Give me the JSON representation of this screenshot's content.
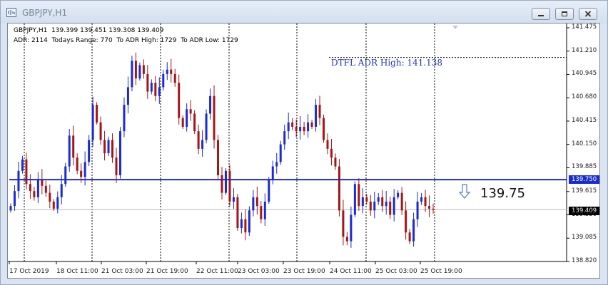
{
  "window": {
    "title": "GBPJPY,H1"
  },
  "chart": {
    "info_line1": "GBPJPY,H1  139.399 139.451 139.308 139.409",
    "info_line2": "ADR: 2114  Todays Range: 770  To ADR High: 1729  To ADR Low: 1729",
    "adr_label": "DTFL ADR High: 141.138",
    "big_price": "139.75",
    "level_tag": "139.750",
    "current_tag": "139.409",
    "colors": {
      "bull": "#1a2ccf",
      "bear": "#a31616",
      "level": "#1a2ccf"
    },
    "icons": {
      "level_arrow": "arrow-down-icon",
      "scroll_marker": "triangle-down-icon"
    }
  },
  "chart_data": {
    "type": "candlestick",
    "symbol": "GBPJPY",
    "timeframe": "H1",
    "ylim": [
      138.82,
      141.475
    ],
    "y_ticks": [
      "141.475",
      "141.210",
      "140.945",
      "140.680",
      "140.415",
      "140.150",
      "139.885",
      "139.615",
      "139.350",
      "139.085",
      "138.820"
    ],
    "x_ticks": [
      "17 Oct 2019",
      "18 Oct 11:00",
      "21 Oct 03:00",
      "21 Oct 19:00",
      "22 Oct 11:00",
      "23 Oct 03:00",
      "23 Oct 19:00",
      "24 Oct 11:00",
      "25 Oct 03:00",
      "25 Oct 19:00"
    ],
    "horizontal_levels": [
      {
        "price": 139.75,
        "label": "139.750"
      },
      {
        "price": 141.138,
        "label": "DTFL ADR High: 141.138"
      },
      {
        "price": 139.409,
        "label": "139.409"
      }
    ],
    "close_path": [
      139.45,
      139.62,
      139.85,
      139.98,
      139.7,
      139.62,
      139.55,
      139.75,
      139.68,
      139.6,
      139.5,
      139.42,
      139.55,
      139.7,
      139.9,
      140.25,
      140.0,
      139.85,
      139.78,
      139.95,
      140.2,
      140.6,
      140.4,
      140.2,
      140.05,
      140.2,
      140.0,
      139.8,
      140.3,
      140.6,
      140.8,
      141.1,
      140.9,
      141.05,
      140.95,
      140.75,
      140.85,
      140.7,
      140.8,
      140.95,
      141.0,
      140.95,
      140.85,
      140.45,
      140.35,
      140.55,
      140.5,
      140.3,
      140.1,
      140.2,
      140.5,
      140.7,
      140.2,
      139.8,
      139.6,
      139.85,
      139.5,
      139.55,
      139.2,
      139.3,
      139.15,
      139.4,
      139.55,
      139.45,
      139.3,
      139.5,
      139.75,
      139.9,
      139.95,
      140.15,
      140.3,
      140.4,
      140.35,
      140.3,
      140.35,
      140.3,
      140.4,
      140.35,
      140.6,
      140.45,
      140.2,
      140.1,
      140.0,
      139.9,
      139.4,
      139.1,
      139.05,
      139.35,
      139.7,
      139.45,
      139.55,
      139.5,
      139.4,
      139.5,
      139.55,
      139.45,
      139.5,
      139.35,
      139.55,
      139.6,
      139.4,
      139.15,
      139.05,
      139.3,
      139.5,
      139.55,
      139.45,
      139.42,
      139.41
    ]
  }
}
